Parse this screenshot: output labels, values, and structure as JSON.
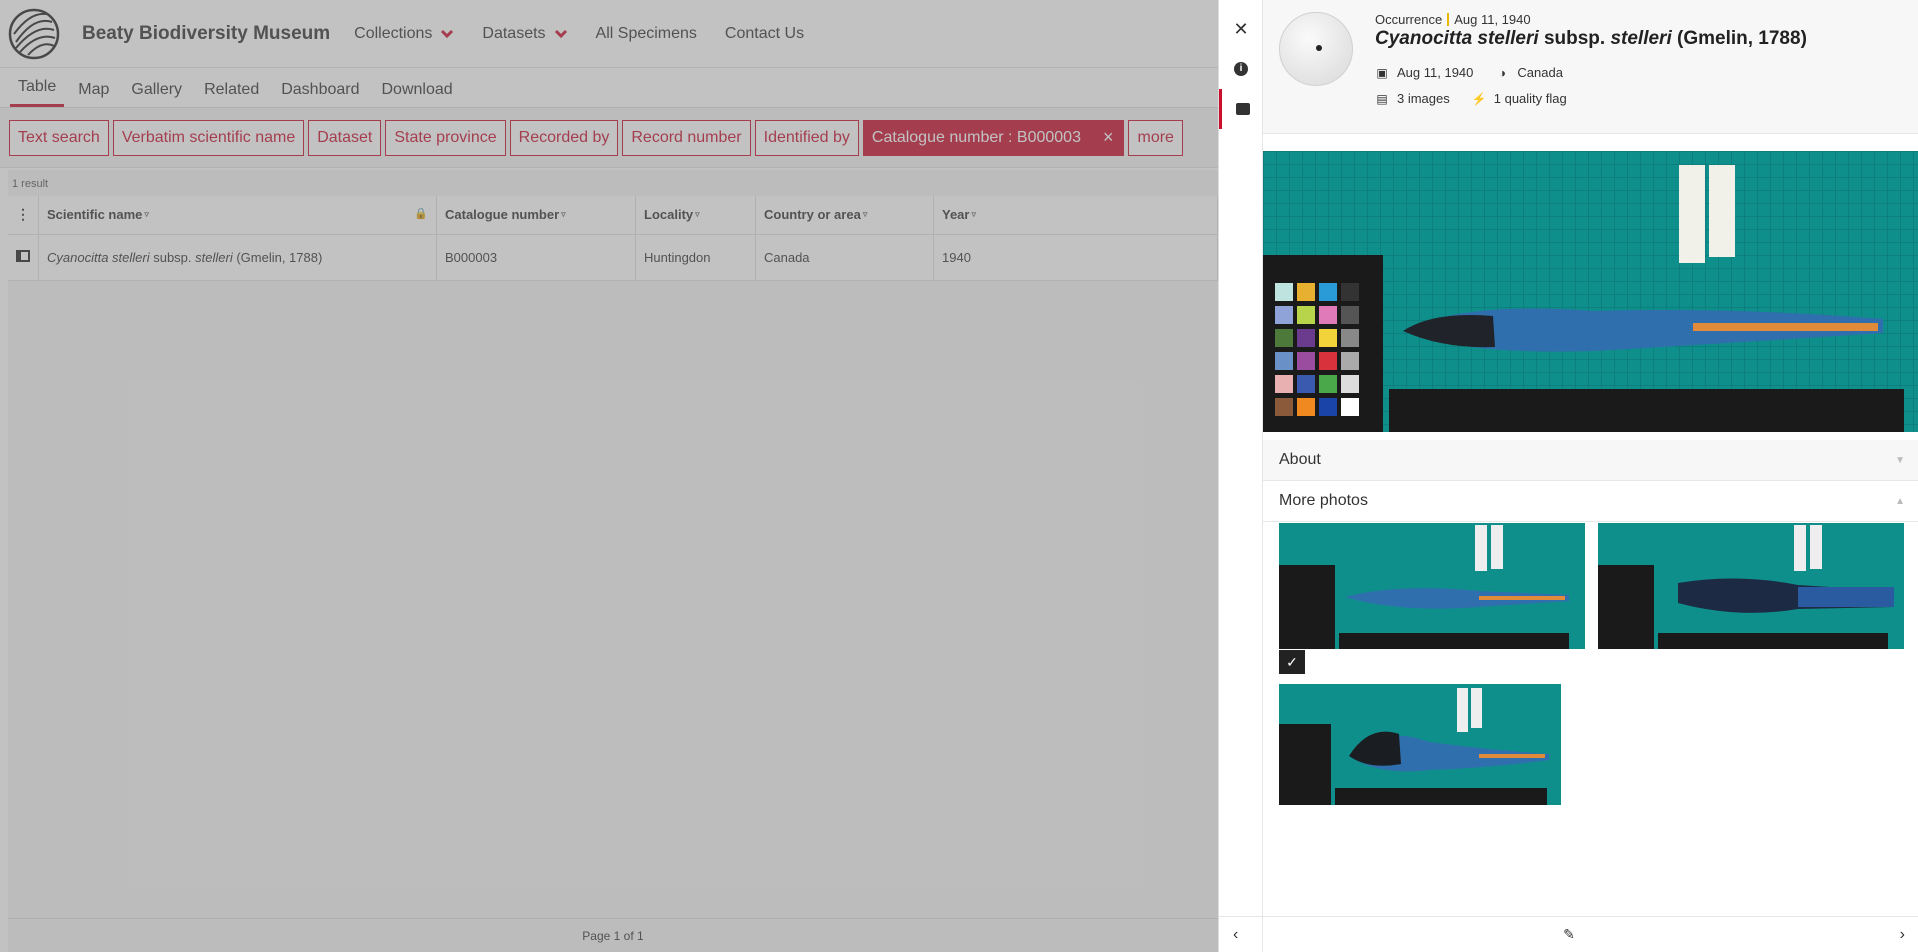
{
  "header": {
    "site_title": "Beaty Biodiversity Museum",
    "nav": [
      {
        "label": "Collections",
        "has_dropdown": true
      },
      {
        "label": "Datasets",
        "has_dropdown": true
      },
      {
        "label": "All Specimens",
        "has_dropdown": false
      },
      {
        "label": "Contact Us",
        "has_dropdown": false
      }
    ]
  },
  "tabs": [
    "Table",
    "Map",
    "Gallery",
    "Related",
    "Dashboard",
    "Download"
  ],
  "active_tab": "Table",
  "filters": [
    "Text search",
    "Verbatim scientific name",
    "Dataset",
    "State province",
    "Recorded by",
    "Record number",
    "Identified by"
  ],
  "active_filter": {
    "label": "Catalogue number : B000003",
    "clear": "×"
  },
  "more_label": "more",
  "results": {
    "count_text": "1 result",
    "columns": [
      "Scientific name",
      "Catalogue number",
      "Locality",
      "Country or area",
      "Year"
    ],
    "rows": [
      {
        "genus_species": "Cyanocitta stelleri",
        "rank": " subsp. ",
        "infra": "stelleri",
        "author": " (Gmelin, 1788)",
        "catalogue": "B000003",
        "locality": "Huntingdon",
        "country": "Canada",
        "year": "1940"
      }
    ],
    "pagination": "Page 1 of 1"
  },
  "drawer": {
    "kind": "Occurrence",
    "date": "Aug 11, 1940",
    "title_italic": "Cyanocitta stelleri",
    "title_rank": " subsp. ",
    "title_infra": "stelleri",
    "title_author": " (Gmelin, 1788)",
    "event_date": "Aug 11, 1940",
    "country": "Canada",
    "images_count": "3 images",
    "quality_flags": "1 quality flag",
    "sections": {
      "about": "About",
      "more_photos": "More photos"
    },
    "colors": {
      "accent": "#c8102e",
      "specimen_bg": "#0f8f8c"
    },
    "icons": [
      "close-icon",
      "info-icon",
      "image-icon",
      "calendar-icon",
      "globe-icon",
      "images-icon",
      "lightning-icon",
      "chevron-left-icon",
      "chevron-right-icon"
    ]
  }
}
